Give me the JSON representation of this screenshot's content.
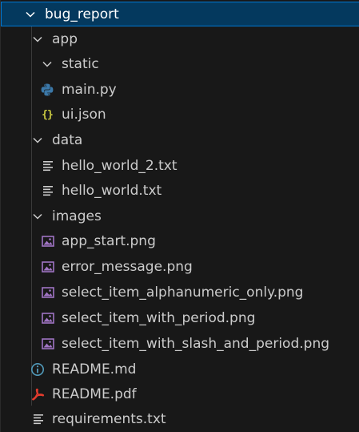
{
  "explorer": {
    "root": {
      "label": "bug_report",
      "expanded": true,
      "icon": "chevron-down-icon"
    },
    "app": {
      "label": "app",
      "expanded": true,
      "static": {
        "label": "static",
        "expanded": true
      },
      "files": [
        {
          "label": "main.py",
          "icon": "python-icon"
        },
        {
          "label": "ui.json",
          "icon": "json-icon"
        }
      ]
    },
    "data": {
      "label": "data",
      "expanded": true,
      "files": [
        {
          "label": "hello_world_2.txt",
          "icon": "text-file-icon"
        },
        {
          "label": "hello_world.txt",
          "icon": "text-file-icon"
        }
      ]
    },
    "images": {
      "label": "images",
      "expanded": true,
      "files": [
        {
          "label": "app_start.png",
          "icon": "image-icon"
        },
        {
          "label": "error_message.png",
          "icon": "image-icon"
        },
        {
          "label": "select_item_alphanumeric_only.png",
          "icon": "image-icon"
        },
        {
          "label": "select_item_with_period.png",
          "icon": "image-icon"
        },
        {
          "label": "select_item_with_slash_and_period.png",
          "icon": "image-icon"
        }
      ]
    },
    "root_files": [
      {
        "label": "README.md",
        "icon": "info-icon"
      },
      {
        "label": "README.pdf",
        "icon": "pdf-icon"
      },
      {
        "label": "requirements.txt",
        "icon": "text-file-icon"
      }
    ]
  },
  "colors": {
    "background": "#181818",
    "selection_bg": "#04395e",
    "selection_border": "#0078d4",
    "text": "#cccccc",
    "guide": "#3a3a3a",
    "python_blue": "#3b78a8",
    "python_yellow": "#f1c232",
    "json_yellow": "#cbcb41",
    "image_purple": "#a074c4",
    "info_blue": "#519aba",
    "pdf_red": "#e13b2d"
  }
}
